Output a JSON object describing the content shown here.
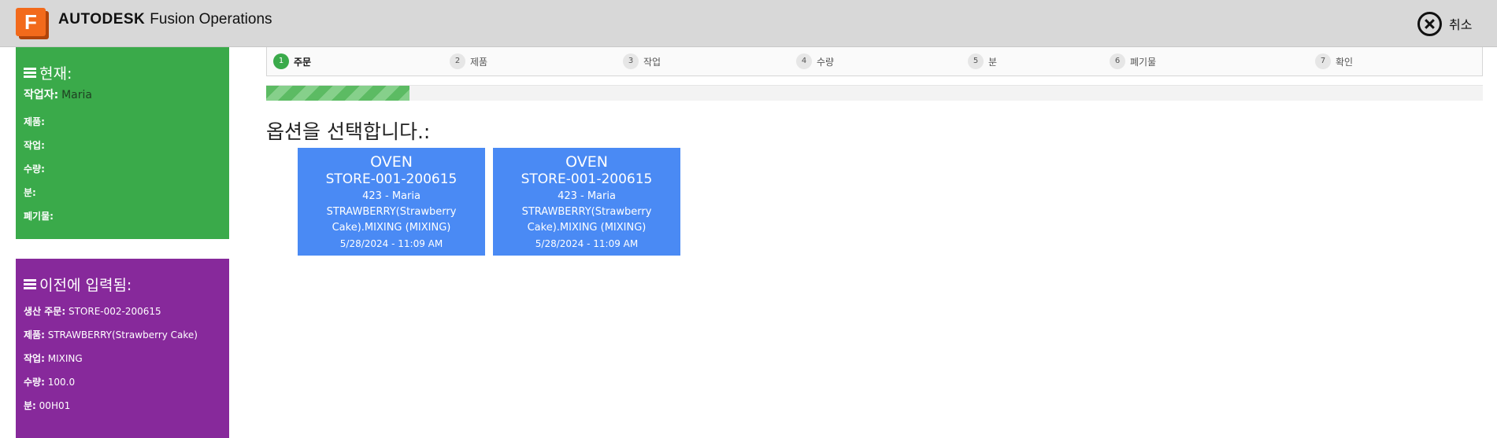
{
  "header": {
    "logo_letter": "F",
    "brand_bold": "AUTODESK",
    "brand_product": "Fusion Operations",
    "cancel_label": "취소",
    "colors": {
      "bar": "#d8d8d8",
      "logo": "#f26a1b"
    }
  },
  "current": {
    "title": "현재:",
    "worker_label": "작업자:",
    "worker_value": "Maria",
    "product_label": "제품:",
    "operation_label": "작업:",
    "quantity_label": "수량:",
    "minutes_label": "분:",
    "scrap_label": "폐기물:",
    "color": "#3aaa4a"
  },
  "previous": {
    "title": "이전에 입력됨:",
    "order_label": "생산 주문:",
    "order_value": "STORE-002-200615",
    "product_label": "제품:",
    "product_value": "STRAWBERRY(Strawberry Cake)",
    "operation_label": "작업:",
    "operation_value": "MIXING",
    "quantity_label": "수량:",
    "quantity_value": "100.0",
    "minutes_label": "분:",
    "minutes_value": "00H01",
    "color": "#87299b"
  },
  "steps": [
    {
      "num": "1",
      "label": "주문",
      "active": true
    },
    {
      "num": "2",
      "label": "제품",
      "active": false
    },
    {
      "num": "3",
      "label": "작업",
      "active": false
    },
    {
      "num": "4",
      "label": "수량",
      "active": false
    },
    {
      "num": "5",
      "label": "분",
      "active": false
    },
    {
      "num": "6",
      "label": "폐기물",
      "active": false
    },
    {
      "num": "7",
      "label": "확인",
      "active": false
    }
  ],
  "progress": {
    "fraction": 0.118,
    "color": "#5cbb63"
  },
  "main": {
    "prompt": "옵션을 선택합니다.:",
    "options": [
      {
        "machine": "OVEN",
        "order": "STORE-001-200615",
        "worker": "423 - Maria",
        "product_op": "STRAWBERRY(Strawberry Cake).MIXING (MIXING)",
        "datetime": "5/28/2024 - 11:09 AM"
      },
      {
        "machine": "OVEN",
        "order": "STORE-001-200615",
        "worker": "423 - Maria",
        "product_op": "STRAWBERRY(Strawberry Cake).MIXING (MIXING)",
        "datetime": "5/28/2024 - 11:09 AM"
      }
    ],
    "card_color": "#4a8af4"
  }
}
